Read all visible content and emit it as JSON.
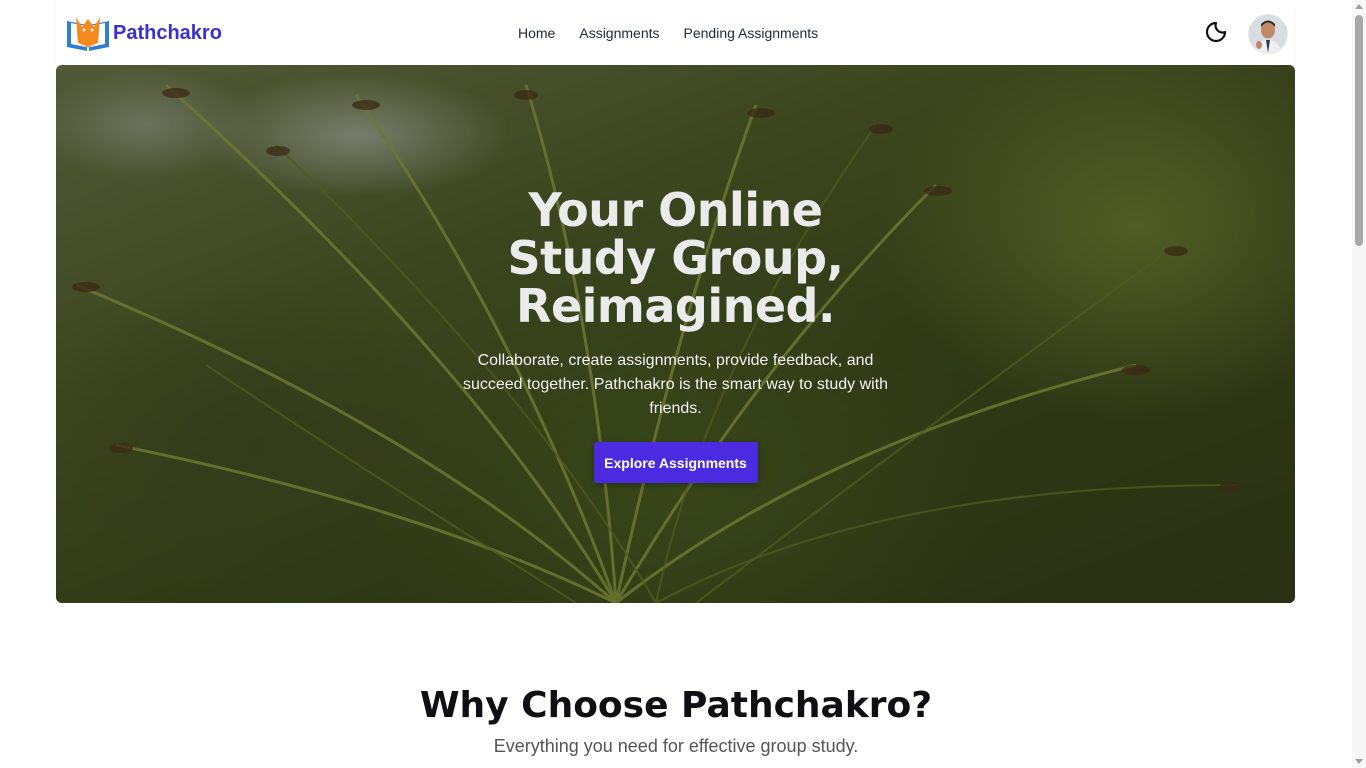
{
  "brand": {
    "name": "Pathchakro",
    "logo_icon": "book-logo-icon"
  },
  "nav": {
    "items": [
      {
        "label": "Home"
      },
      {
        "label": "Assignments"
      },
      {
        "label": "Pending Assignments"
      }
    ]
  },
  "header": {
    "theme_icon": "moon-icon",
    "avatar_icon": "user-avatar"
  },
  "hero": {
    "title": "Your Online Study Group, Reimagined.",
    "subtitle": "Collaborate, create assignments, provide feedback, and succeed together. Pathchakro is the smart way to study with friends.",
    "cta_label": "Explore Assignments"
  },
  "features": {
    "title": "Why Choose Pathchakro?",
    "subtitle": "Everything you need for effective group study."
  },
  "colors": {
    "accent": "#4a2be0",
    "brand": "#3c2fd0",
    "hero_green": "#5c6b2e"
  }
}
